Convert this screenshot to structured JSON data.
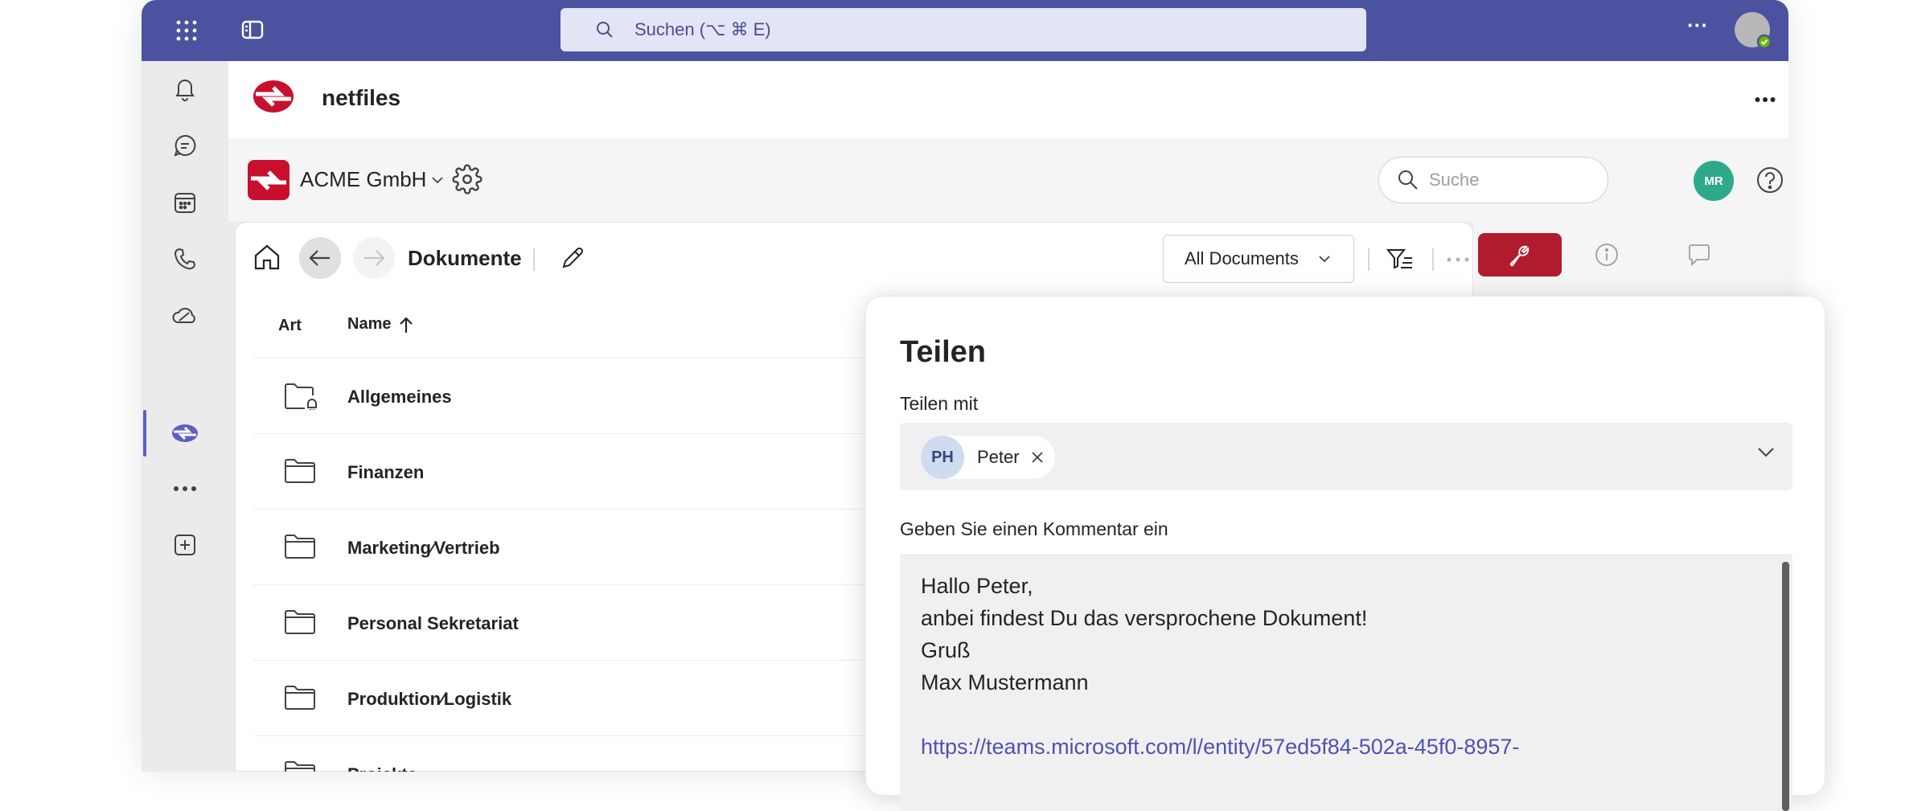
{
  "titlebar": {
    "search_placeholder": "Suchen (⌥ ⌘ E)",
    "more_label": "···",
    "accent": "#4b53a0"
  },
  "rail": {
    "items": [
      "activity",
      "chat",
      "calendar",
      "calls",
      "onedrive",
      "netfiles",
      "more",
      "add-apps"
    ],
    "active": "netfiles"
  },
  "app": {
    "name": "netfiles",
    "brand_color": "#c8102e"
  },
  "toolbar": {
    "workspace": "ACME GmbH",
    "search_placeholder": "Suche",
    "avatar_initials": "MR",
    "avatar_color": "#2eaa8a"
  },
  "content": {
    "breadcrumb": "Dokumente",
    "view_select": "All Documents",
    "columns": {
      "type": "Art",
      "name": "Name"
    },
    "rows": [
      {
        "name": "Allgemeines",
        "icon": "shared-folder-icon"
      },
      {
        "name": "Finanzen",
        "icon": "folder-icon"
      },
      {
        "name": "Marketing∕Vertrieb",
        "icon": "folder-icon"
      },
      {
        "name": "Personal Sekretariat",
        "icon": "folder-icon"
      },
      {
        "name": "Produktion∕Logistik",
        "icon": "folder-icon"
      },
      {
        "name": "Projekte",
        "icon": "folder-icon"
      }
    ]
  },
  "dialog": {
    "title": "Teilen",
    "share_with_label": "Teilen mit",
    "recipients": [
      {
        "initials": "PH",
        "name": "Peter"
      }
    ],
    "comment_label": "Geben Sie einen Kommentar ein",
    "comment_lines": [
      "Hallo Peter,",
      "anbei findest Du das versprochene Dokument!",
      "Gruß",
      "Max Mustermann"
    ],
    "comment_link": "https://teams.microsoft.com/l/entity/57ed5f84-502a-45f0-8957-"
  }
}
